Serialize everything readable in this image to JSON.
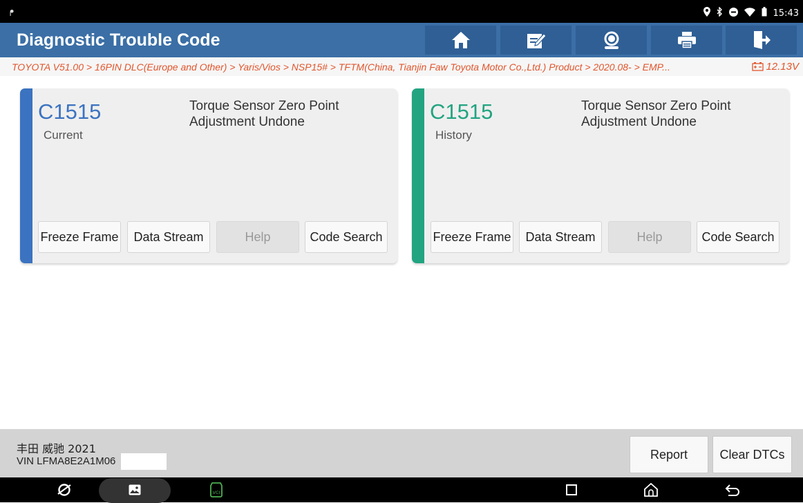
{
  "status_bar": {
    "usb_icon": "usb-icon",
    "time": "15:43"
  },
  "header": {
    "title": "Diagnostic Trouble Code",
    "buttons": [
      "home-icon",
      "edit-icon",
      "support-icon",
      "print-icon",
      "exit-icon"
    ]
  },
  "breadcrumb": {
    "path": "TOYOTA V51.00 > 16PIN DLC(Europe and Other) > Yaris/Vios > NSP15# > TFTM(China, Tianjin Faw Toyota Motor Co.,Ltd.) Product > 2020.08- > EMP...",
    "voltage": "12.13V"
  },
  "dtc_cards": [
    {
      "code": "C1515",
      "status": "Current",
      "description": "Torque Sensor Zero Point Adjustment Undone",
      "accent": "#3b73c0",
      "buttons": [
        "Freeze Frame",
        "Data Stream",
        "Help",
        "Code Search"
      ]
    },
    {
      "code": "C1515",
      "status": "History",
      "description": "Torque Sensor Zero Point Adjustment Undone",
      "accent": "#22a481",
      "buttons": [
        "Freeze Frame",
        "Data Stream",
        "Help",
        "Code Search"
      ]
    }
  ],
  "footer": {
    "vehicle": "丰田 威驰 2021",
    "vin": "VIN LFMA8E2A1M06",
    "report_label": "Report",
    "clear_label": "Clear DTCs"
  },
  "nav_bar": {
    "icons": [
      "browser-icon",
      "gallery-icon",
      "vci-icon",
      "recents-icon",
      "home-icon",
      "back-icon"
    ],
    "vci_label": "VCI"
  },
  "colors": {
    "header_bg": "#3b6fa6",
    "breadcrumb_text": "#e1552c",
    "current_accent": "#3b73c0",
    "history_accent": "#22a481"
  }
}
